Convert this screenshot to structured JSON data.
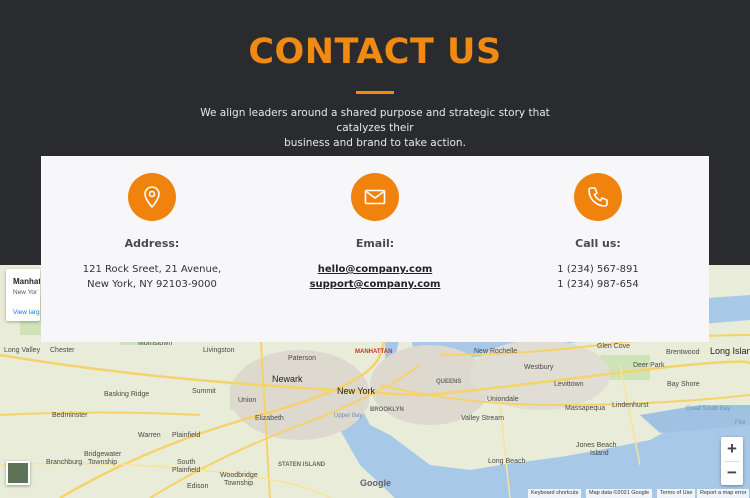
{
  "header": {
    "title": "CONTACT US",
    "subtitle_line1": "We align leaders around a shared purpose and strategic story that catalyzes their",
    "subtitle_line2": "business and brand to take action."
  },
  "colors": {
    "accent": "#f08a12",
    "background": "#2a2b2f",
    "card": "#f7f7f9"
  },
  "contact": {
    "address": {
      "icon": "location-pin-icon",
      "title": "Address:",
      "line1": "121 Rock Sreet, 21 Avenue,",
      "line2": "New York, NY 92103-9000"
    },
    "email": {
      "icon": "envelope-icon",
      "title": "Email:",
      "line1": "hello@company.com",
      "line2": "support@company.com"
    },
    "phone": {
      "icon": "phone-icon",
      "title": "Call us:",
      "line1": "1 (234) 567-891",
      "line2": "1 (234) 987-654"
    }
  },
  "map": {
    "place_name": "Manhat",
    "place_sub": "New Yor",
    "view_larger": "View larg",
    "labels": {
      "long_valley": "Long Valley",
      "chester": "Chester",
      "morristown": "Morristown",
      "livingston": "Livingston",
      "paterson": "Paterson",
      "manhattan": "MANHATTAN",
      "new_rochelle": "New Rochelle",
      "glen_cove": "Glen Cove",
      "brentwood": "Brentwood",
      "long_island": "Long Island",
      "newark": "Newark",
      "new_york": "New York",
      "queens": "QUEENS",
      "westbury": "Westbury",
      "levittown": "Levittown",
      "deer_park": "Deer Park",
      "bay_shore": "Bay Shore",
      "summit": "Summit",
      "basking_ridge": "Basking Ridge",
      "union": "Union",
      "brooklyn": "BROOKLYN",
      "uniondale": "Uniondale",
      "massapequa": "Massapequa",
      "lindenhurst": "Lindenhurst",
      "elizabeth": "Elizabeth",
      "great_south_bay": "Great South Bay",
      "bedminster": "Bedminster",
      "valley_stream": "Valley Stream",
      "warren": "Warren",
      "plainfield": "Plainfield",
      "bridgewater": "Bridgewater",
      "branchburg": "Branchburg",
      "township": "Township",
      "south": "South",
      "plainfield2": "Plainfield",
      "staten_island": "STATEN ISLAND",
      "jones_beach": "Jones Beach",
      "island": "Island",
      "long_beach": "Long Beach",
      "woodbridge": "Woodbridge",
      "township2": "Township",
      "edison": "Edison",
      "upper_bay": "Upper Bay",
      "fire": "Fire"
    },
    "google_logo": "Google",
    "keyboard_shortcuts": "Keyboard shortcuts",
    "map_data": "Map data ©2021 Google",
    "terms": "Terms of Use",
    "report": "Report a map error",
    "zoom_in": "+",
    "zoom_out": "−"
  }
}
